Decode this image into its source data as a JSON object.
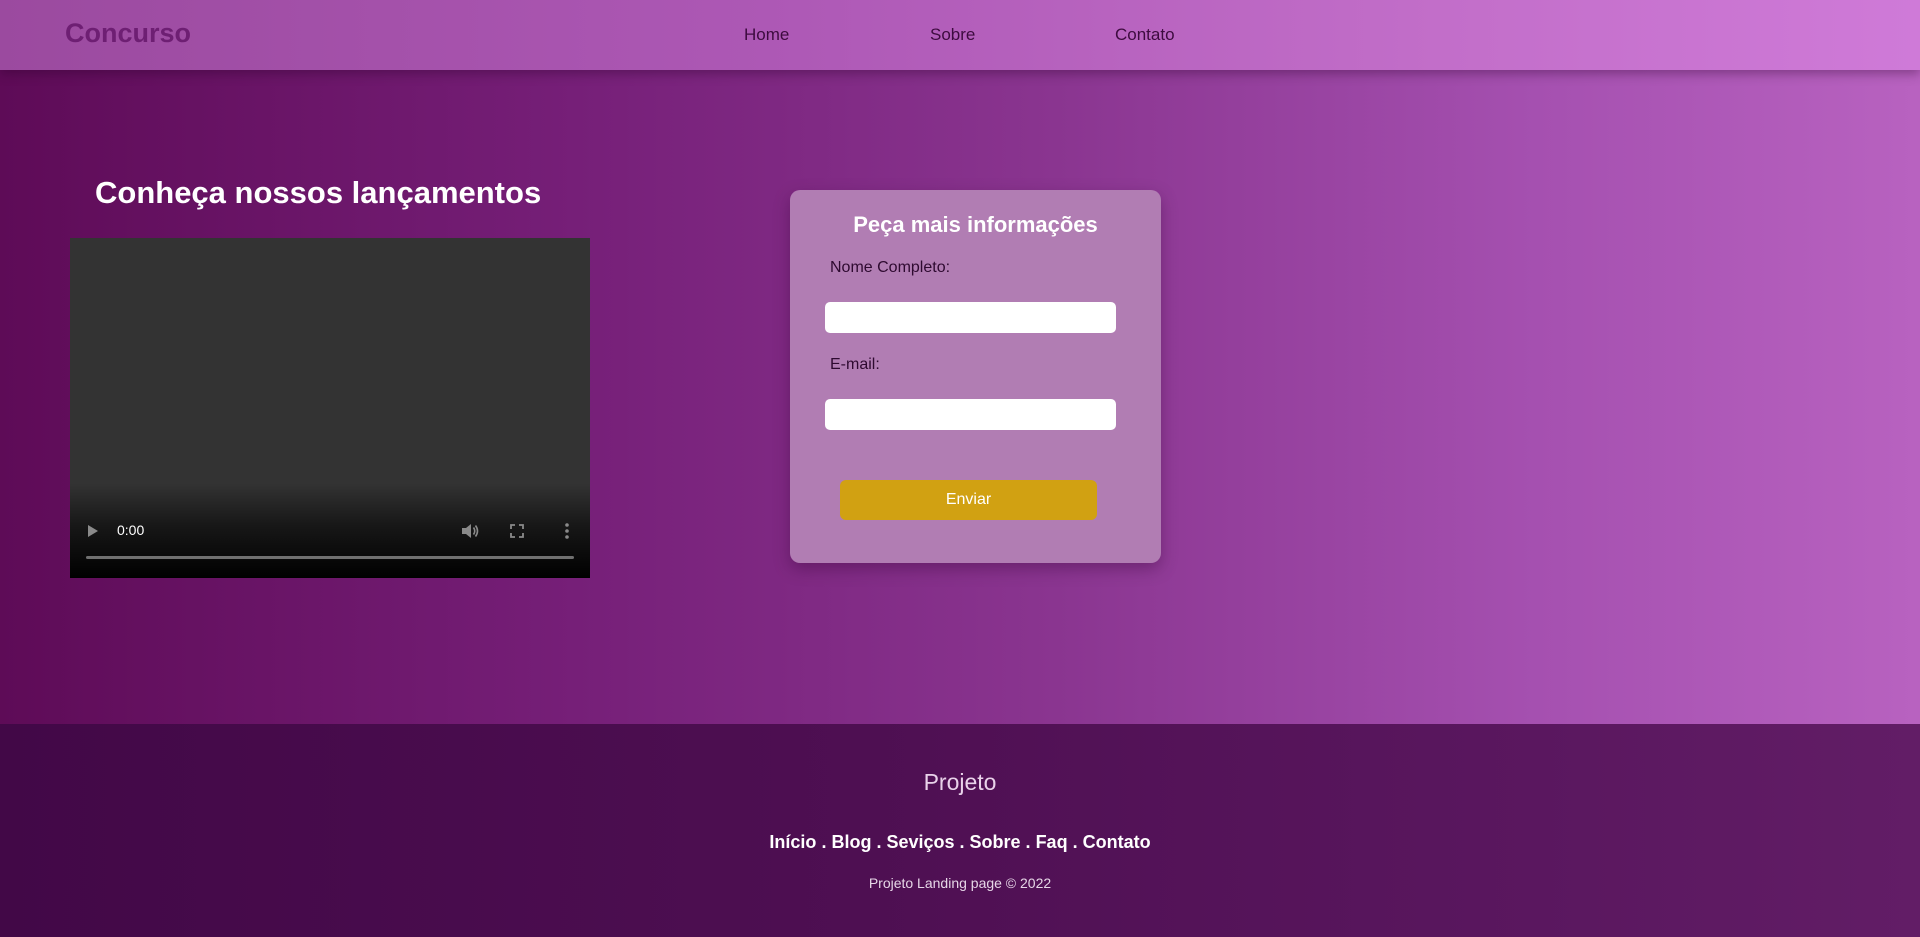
{
  "header": {
    "logo": "Concurso",
    "nav": [
      {
        "label": "Home"
      },
      {
        "label": "Sobre"
      },
      {
        "label": "Contato"
      }
    ]
  },
  "main": {
    "headline": "Conheça nossos lançamentos",
    "video": {
      "time": "0:00",
      "progress": 0,
      "icons": [
        "play-icon",
        "volume-icon",
        "fullscreen-icon",
        "more-options-icon"
      ]
    },
    "form": {
      "title": "Peça mais informações",
      "name_label": "Nome Completo:",
      "name_value": "",
      "email_label": "E-mail:",
      "email_value": "",
      "submit_label": "Enviar"
    }
  },
  "footer": {
    "title": "Projeto",
    "links": [
      "Início",
      "Blog",
      "Seviços",
      "Sobre",
      "Faq",
      "Contato"
    ],
    "separator": " . ",
    "copyright": "Projeto Landing page © 2022"
  },
  "colors": {
    "header_start": "#9b4a9f",
    "header_end": "#cf7ad8",
    "main_start": "#5e0b57",
    "main_end": "#b862c0",
    "card": "#b17db3",
    "button": "#d1a112",
    "footer": "#4e0f52"
  }
}
